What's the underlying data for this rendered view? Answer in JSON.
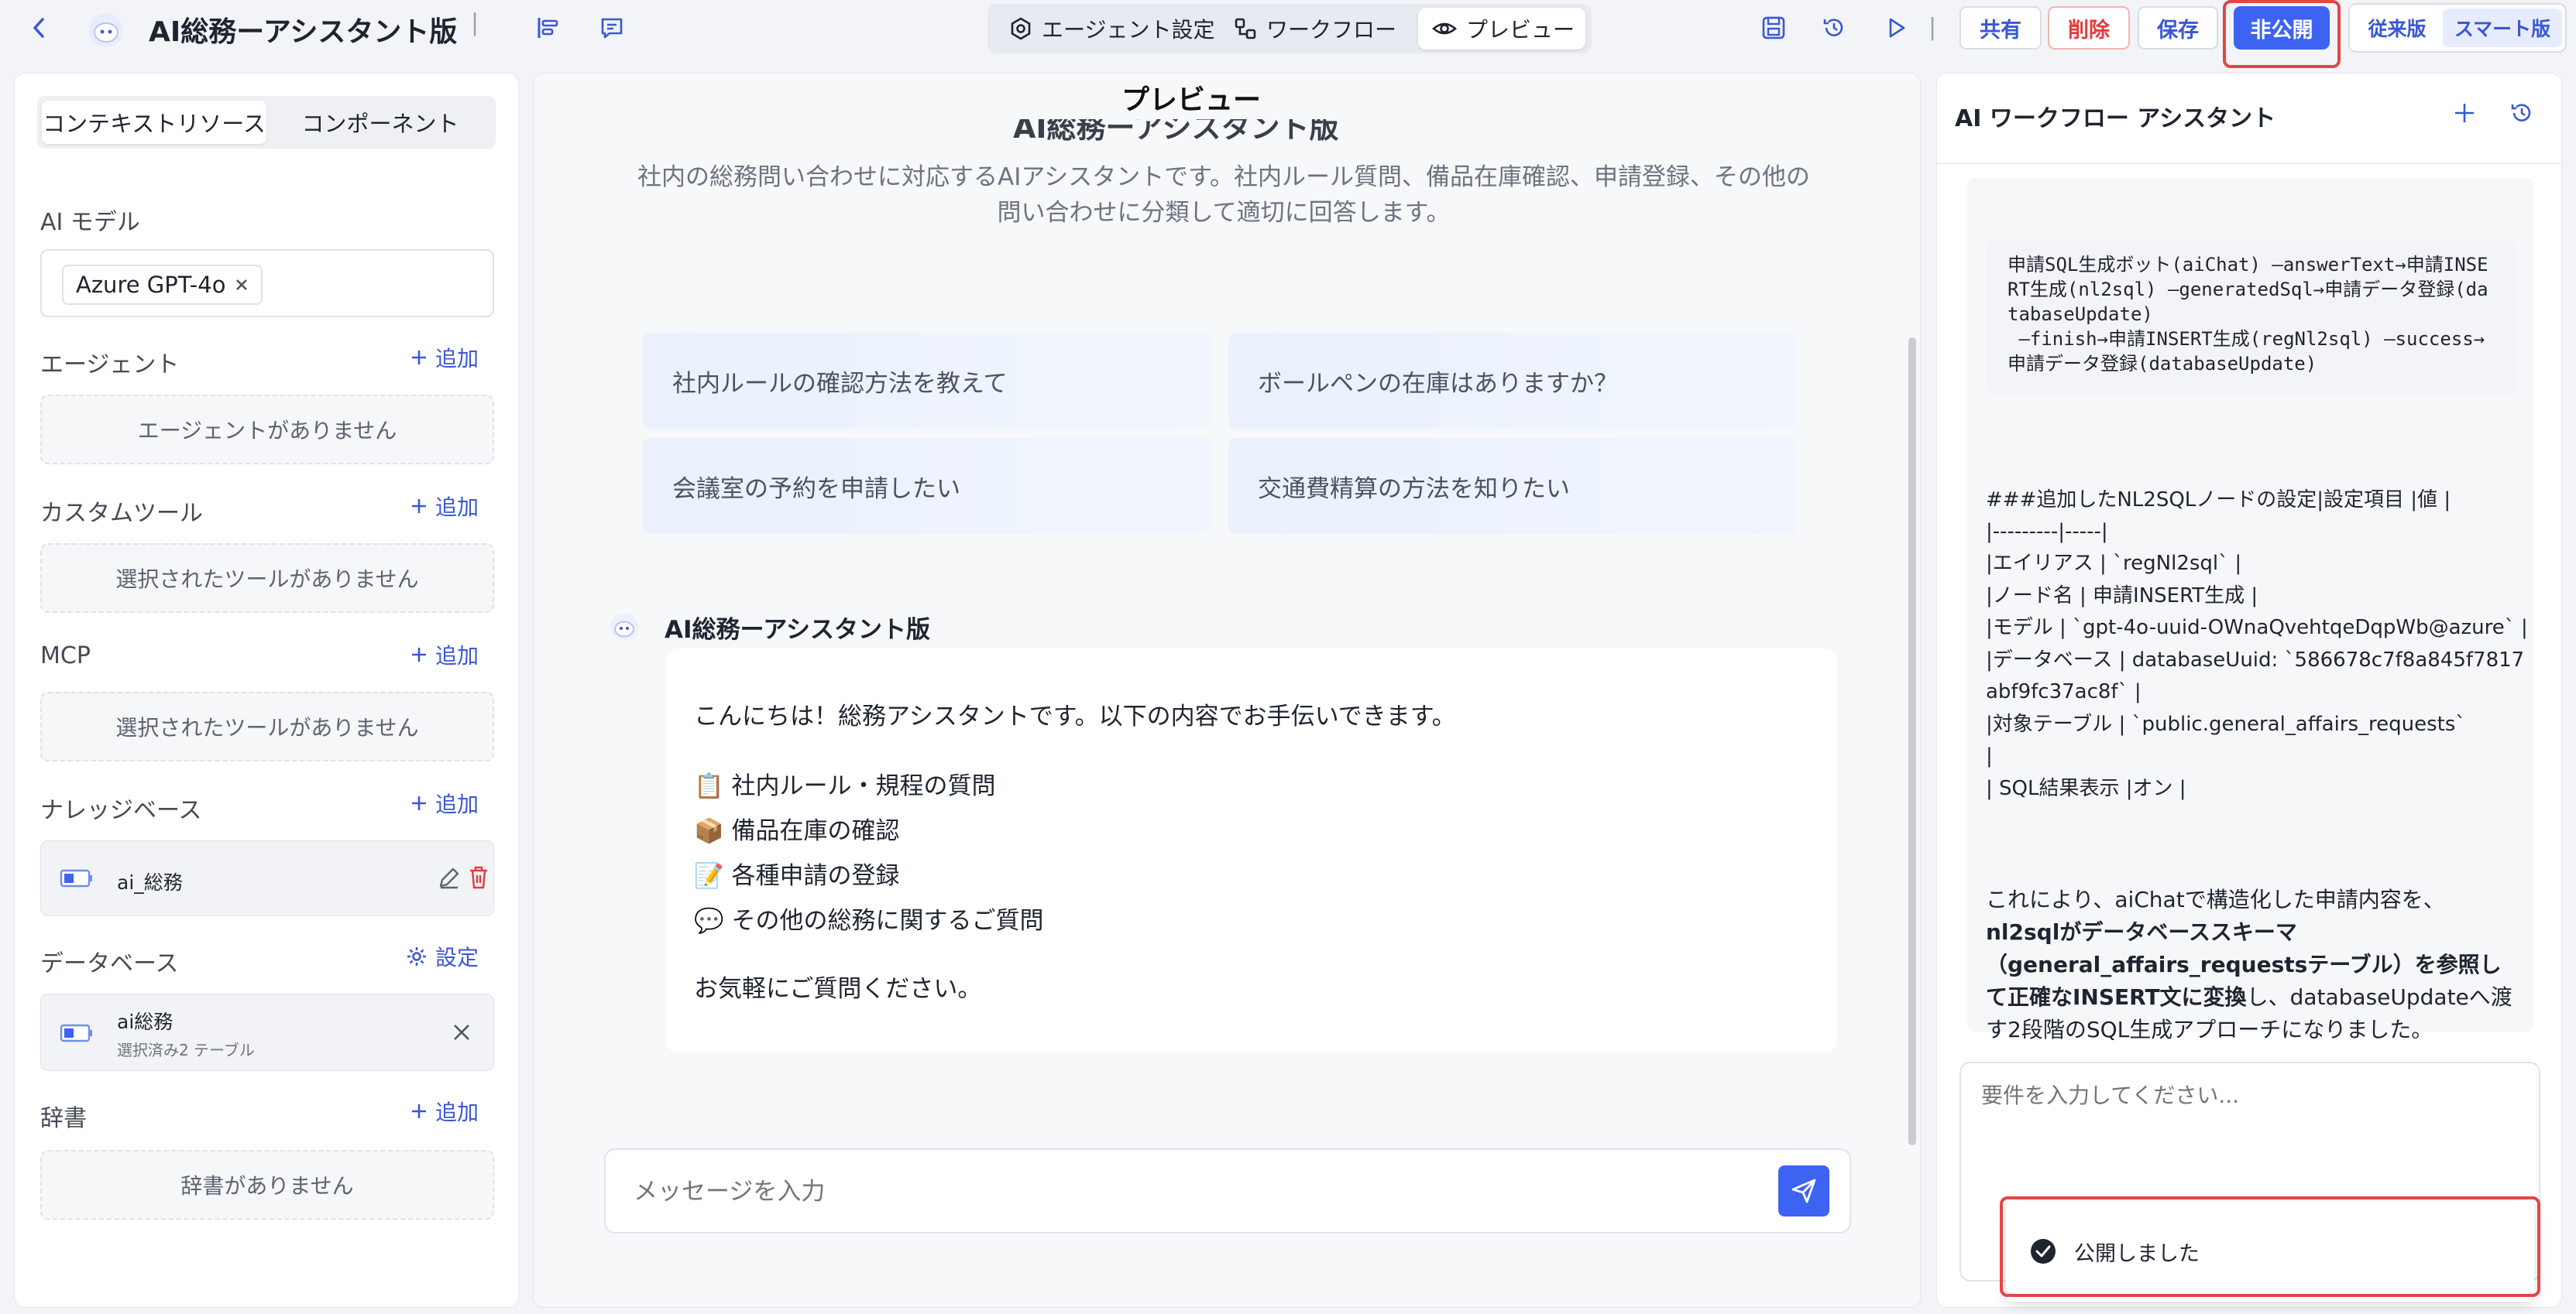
{
  "header": {
    "title": "AI総務ーアシスタント版",
    "separator": "|",
    "tabs": [
      {
        "label": "エージェント設定",
        "icon": "settings-icon"
      },
      {
        "label": "ワークフロー",
        "icon": "workflow-icon"
      },
      {
        "label": "プレビュー",
        "icon": "eye-icon",
        "active": true
      }
    ],
    "actions": {
      "share": "共有",
      "delete": "削除",
      "save": "保存",
      "unpublish": "非公開"
    },
    "version_toggle": {
      "legacy": "従来版",
      "smart": "スマート版",
      "active": "スマート版"
    }
  },
  "left_panel": {
    "tabs": [
      "コンテキストリソース",
      "コンポーネント"
    ],
    "active_tab": "コンテキストリソース",
    "ai_model": {
      "label": "AI モデル",
      "selected": "Azure GPT-4o"
    },
    "sections": {
      "agent": {
        "title": "エージェント",
        "add": "追加",
        "empty": "エージェントがありません"
      },
      "custom_tool": {
        "title": "カスタムツール",
        "add": "追加",
        "empty": "選択されたツールがありません"
      },
      "mcp": {
        "title": "MCP",
        "add": "追加",
        "empty": "選択されたツールがありません"
      },
      "knowledge": {
        "title": "ナレッジベース",
        "add": "追加",
        "item": "ai_総務"
      },
      "database": {
        "title": "データベース",
        "settings": "設定",
        "item_name": "ai総務",
        "item_sub": "選択済み2 テーブル"
      },
      "dictionary": {
        "title": "辞書",
        "add": "追加",
        "empty": "辞書がありません"
      }
    }
  },
  "preview": {
    "title": "プレビュー",
    "agent_name": "AI総務ーアシスタント版",
    "description": "社内の総務問い合わせに対応するAIアシスタントです。社内ルール質問、備品在庫確認、申請登録、その他の問い合わせに分類して適切に回答します。",
    "suggestions": [
      "社内ルールの確認方法を教えて",
      "ボールペンの在庫はありますか？",
      "会議室の予約を申請したい",
      "交通費精算の方法を知りたい"
    ],
    "message": {
      "sender": "AI総務ーアシスタント版",
      "greeting": "こんにちは！総務アシスタントです。以下の内容でお手伝いできます。",
      "items": [
        {
          "emoji": "📋",
          "text": "社内ルール・規程の質問"
        },
        {
          "emoji": "📦",
          "text": "備品在庫の確認"
        },
        {
          "emoji": "📝",
          "text": "各種申請の登録"
        },
        {
          "emoji": "💬",
          "text": "その他の総務に関するご質問"
        }
      ],
      "closing": "お気軽にご質問ください。"
    },
    "input_placeholder": "メッセージを入力"
  },
  "assistant": {
    "title": "AI ワークフロー アシスタント",
    "code": "申請SQL生成ボット(aiChat) —answerText→申請INSE\nRT生成(nl2sql) —generatedSql→申請データ登録(da\ntabaseUpdate)\n —finish→申請INSERT生成(regNl2sql) —success→\n申請データ登録(databaseUpdate)",
    "table_lines": [
      "###追加したNL2SQLノードの設定|設定項目 |値 |",
      "|---------|-----|",
      "|エイリアス | `regNl2sql` |",
      "|ノード名 | 申請INSERT生成 |",
      "|モデル | `gpt-4o-uuid-OWnaQvehtqeDqpWb@azure` |",
      "|データベース | databaseUuid: `586678c7f8a845f7817",
      "abf9fc37ac8f` |",
      "|対象テーブル | `public.general_affairs_requests`",
      "|",
      "| SQL結果表示 |オン |"
    ],
    "summary_parts": {
      "p1": "これにより、aiChatで構造化した申請内容を、",
      "b1": "nl2sqlがデータベーススキーマ（general_affairs_requestsテーブル）を参照して正確なINSERT文に変換",
      "p2": "し、databaseUpdateへ渡す2段階のSQL生成アプローチになりました。"
    },
    "input_placeholder": "要件を入力してください..."
  },
  "toast": {
    "message": "公開しました"
  },
  "colors": {
    "accent": "#3d63f2",
    "danger": "#e23b3b",
    "highlight_frame": "#e34646"
  }
}
